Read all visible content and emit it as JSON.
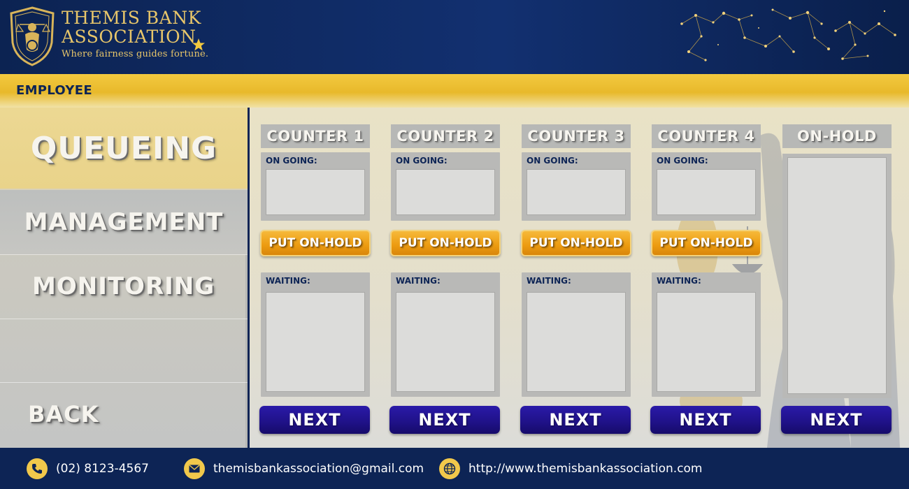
{
  "brand": {
    "name_line1": "THEMIS BANK",
    "name_line2": "ASSOCIATION",
    "tagline": "Where fairness guides fortune."
  },
  "role": "EMPLOYEE",
  "sidebar": {
    "items": [
      {
        "label": "QUEUEING",
        "active": true
      },
      {
        "label": "MANAGEMENT"
      },
      {
        "label": "MONITORING"
      }
    ],
    "back_label": "BACK"
  },
  "counters": [
    {
      "title": "COUNTER 1",
      "ongoing_label": "ON GOING:",
      "hold_label": "PUT ON-HOLD",
      "waiting_label": "WAITING:",
      "next_label": "NEXT"
    },
    {
      "title": "COUNTER 2",
      "ongoing_label": "ON GOING:",
      "hold_label": "PUT ON-HOLD",
      "waiting_label": "WAITING:",
      "next_label": "NEXT"
    },
    {
      "title": "COUNTER 3",
      "ongoing_label": "ON GOING:",
      "hold_label": "PUT ON-HOLD",
      "waiting_label": "WAITING:",
      "next_label": "NEXT"
    },
    {
      "title": "COUNTER 4",
      "ongoing_label": "ON GOING:",
      "hold_label": "PUT ON-HOLD",
      "waiting_label": "WAITING:",
      "next_label": "NEXT"
    }
  ],
  "onhold": {
    "title": "ON-HOLD",
    "next_label": "NEXT"
  },
  "footer": {
    "phone": "(02) 8123-4567",
    "email": "themisbankassociation@gmail.com",
    "website": "http://www.themisbankassociation.com"
  },
  "colors": {
    "navy": "#0d2455",
    "gold": "#e8c66a",
    "orange_button": "#ec9b10",
    "purple_button": "#20128a"
  },
  "icons": [
    "shield-logo-icon",
    "star-icon",
    "constellation-decor",
    "phone-icon",
    "mail-icon",
    "globe-icon"
  ]
}
